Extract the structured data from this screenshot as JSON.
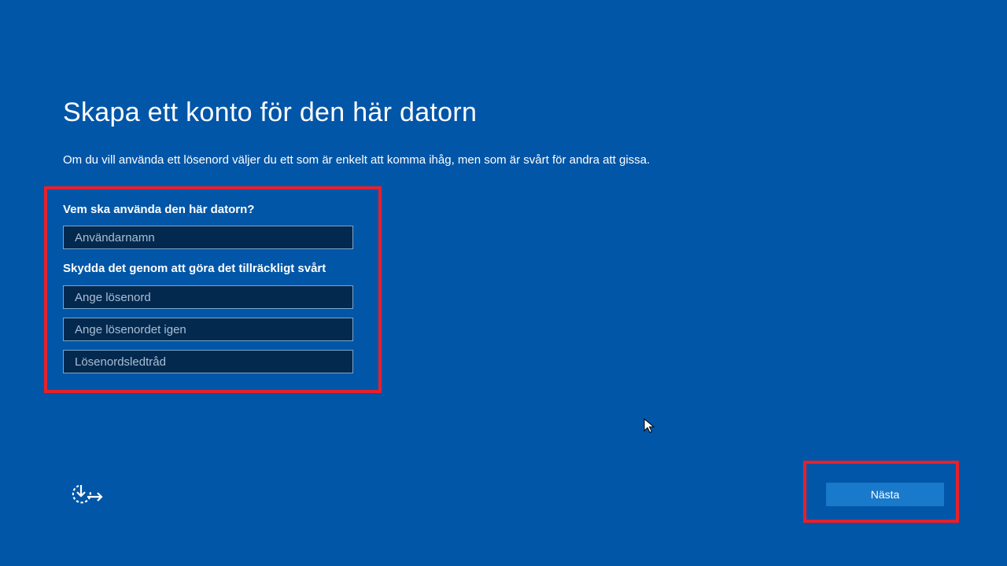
{
  "page": {
    "title": "Skapa ett konto för den här datorn",
    "intro": "Om du vill använda ett lösenord väljer du ett som är enkelt att komma ihåg, men som är svårt för andra att gissa."
  },
  "form": {
    "who_label": "Vem ska använda den här datorn?",
    "username_placeholder": "Användarnamn",
    "protect_label": "Skydda det genom att göra det tillräckligt svårt",
    "password_placeholder": "Ange lösenord",
    "password_confirm_placeholder": "Ange lösenordet igen",
    "hint_placeholder": "Lösenordsledtråd"
  },
  "footer": {
    "next_label": "Nästa",
    "accessibility_icon": "ease-of-access-icon"
  },
  "colors": {
    "background": "#0156a8",
    "field_background": "#04294f",
    "button": "#1979ca",
    "highlight": "#e8202a"
  }
}
